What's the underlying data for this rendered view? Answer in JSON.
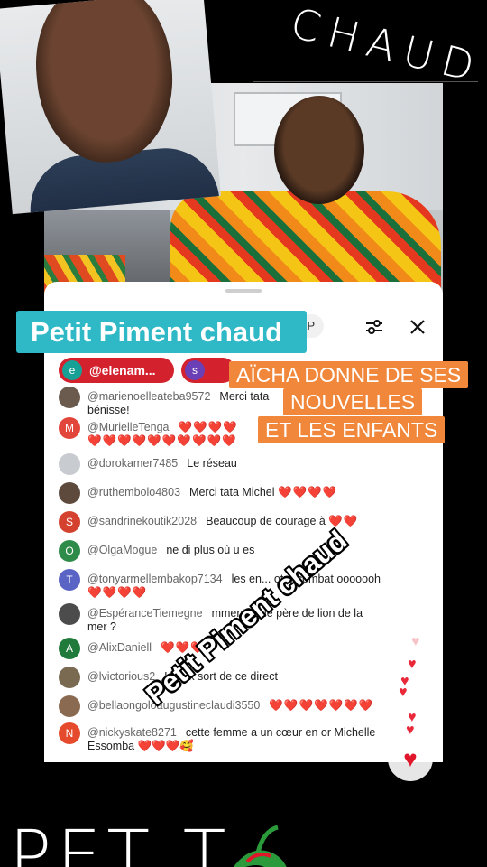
{
  "top_handwriting": "CHAUD",
  "panel": {
    "xp_label": "0 XP",
    "chips": [
      {
        "initial": "e",
        "label": "@elenam..."
      },
      {
        "initial": "s",
        "label": ""
      }
    ],
    "comments": [
      {
        "initial": "",
        "user": "@marienoelleateba9572",
        "text": "Merci tata",
        "text2": "bénisse!"
      },
      {
        "initial": "M",
        "user": "@MurielleTenga",
        "text": "❤️❤️❤️❤️",
        "text2": "❤️❤️❤️❤️❤️❤️❤️❤️❤️❤️"
      },
      {
        "initial": "",
        "user": "@dorokamer7485",
        "text": "Le réseau"
      },
      {
        "initial": "",
        "user": "@ruthembolo4803",
        "text": "Merci tata Michel",
        "hearts": "❤️❤️❤️❤️"
      },
      {
        "initial": "S",
        "user": "@sandrinekoutik2028",
        "text": "Beaucoup de courage à",
        "hearts": "❤️❤️"
      },
      {
        "initial": "O",
        "user": "@OlgaMogue",
        "text": "ne di plus où u es"
      },
      {
        "initial": "T",
        "user": "@tonyarmellembakop7134",
        "text": "les en... otre combat ooooooh",
        "text2": "❤️❤️❤️❤️"
      },
      {
        "initial": "",
        "user": "@EspéranceTiemegne",
        "text": "mment va le père de lion de la",
        "text2": "mer ?"
      },
      {
        "initial": "A",
        "user": "@AlixDaniell",
        "text": "",
        "hearts": "❤️❤️❤️"
      },
      {
        "initial": "",
        "user": "@lvictorious2",
        "text": "Ladyk sort de ce direct"
      },
      {
        "initial": "",
        "user": "@bellaongoloaugustineclaudi3550",
        "text": "",
        "hearts": "❤️❤️❤️❤️❤️❤️❤️"
      },
      {
        "initial": "N",
        "user": "@nickyskate8271",
        "text": "cette femme a un cœur en or Michelle",
        "text2": "Essomba ❤️❤️❤️🥰"
      }
    ]
  },
  "overlays": {
    "title_banner": "Petit Piment chaud",
    "orange_lines": [
      "AÏCHA DONNE DE SES",
      "NOUVELLES",
      "ET LES ENFANTS"
    ],
    "diagonal_text": "Petit Piment chaud"
  },
  "bottom_handwriting": "PET  T",
  "colors": {
    "accent_teal": "#2fb8c5",
    "overlay_orange": "#f1873a",
    "chip_red": "#d4212e",
    "heart_red": "#e0172a"
  },
  "icons": [
    "filter-icon",
    "close-icon",
    "heart-icon"
  ]
}
